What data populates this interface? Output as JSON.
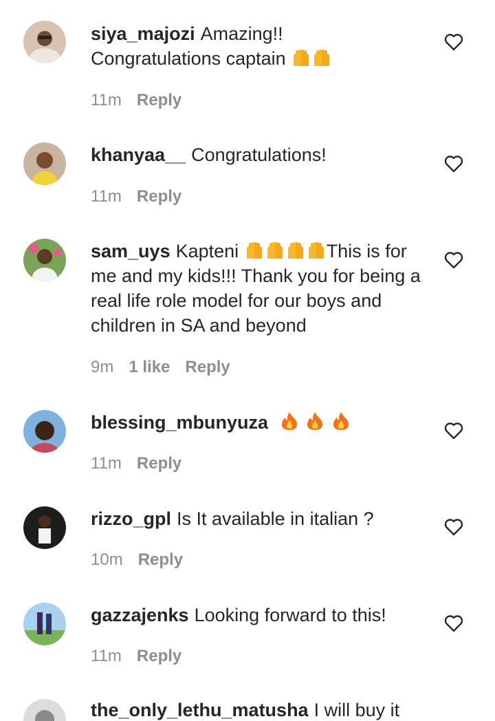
{
  "comments": [
    {
      "username": "siya_majozi",
      "text_line1": "Amazing!!",
      "text_line2": "Congratulations captain",
      "time": "11m",
      "reply": "Reply",
      "emoji": "raised-hands"
    },
    {
      "username": "khanyaa__",
      "text": "Congratulations!",
      "time": "11m",
      "reply": "Reply"
    },
    {
      "username": "sam_uys",
      "text_pre": "Kapteni",
      "text_post": "This is for me and my kids!!! Thank you for being a real life role model for our boys and children in SA and beyond",
      "time": "9m",
      "likes": "1 like",
      "reply": "Reply",
      "emoji": "raised-hands"
    },
    {
      "username": "blessing_mbunyuza",
      "time": "11m",
      "reply": "Reply",
      "emoji": "fire"
    },
    {
      "username": "rizzo_gpl",
      "text": "Is It available in italian ?",
      "time": "10m",
      "reply": "Reply"
    },
    {
      "username": "gazzajenks",
      "text": "Looking forward to this!",
      "time": "11m",
      "reply": "Reply"
    },
    {
      "username": "the_only_lethu_matusha",
      "text": "I will buy it"
    }
  ],
  "icons": {
    "like": "heart-outline-icon",
    "emoji_hands": "raised-hands-emoji",
    "emoji_fire": "fire-emoji"
  },
  "colors": {
    "text": "#262626",
    "secondary": "#8e8e8e",
    "background": "#ffffff"
  }
}
